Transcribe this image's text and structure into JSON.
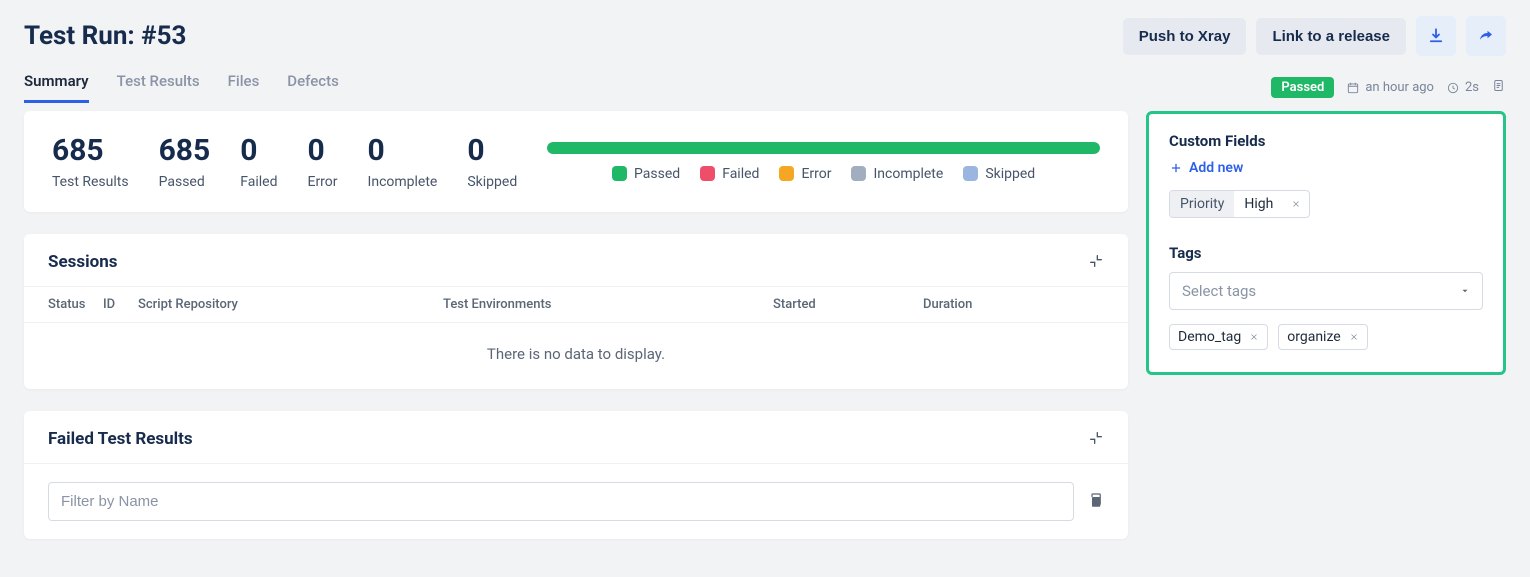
{
  "header": {
    "title": "Test Run: #53",
    "push_label": "Push to Xray",
    "link_label": "Link to a release"
  },
  "tabs": [
    "Summary",
    "Test Results",
    "Files",
    "Defects"
  ],
  "meta": {
    "status_badge": "Passed",
    "timestamp": "an hour ago",
    "duration": "2s"
  },
  "stats": {
    "test_results": {
      "value": "685",
      "label": "Test Results"
    },
    "passed": {
      "value": "685",
      "label": "Passed"
    },
    "failed": {
      "value": "0",
      "label": "Failed"
    },
    "error": {
      "value": "0",
      "label": "Error"
    },
    "incomplete": {
      "value": "0",
      "label": "Incomplete"
    },
    "skipped": {
      "value": "0",
      "label": "Skipped"
    }
  },
  "legend": {
    "passed": "Passed",
    "failed": "Failed",
    "error": "Error",
    "incomplete": "Incomplete",
    "skipped": "Skipped"
  },
  "sessions": {
    "title": "Sessions",
    "columns": {
      "status": "Status",
      "id": "ID",
      "repo": "Script Repository",
      "env": "Test Environments",
      "started": "Started",
      "duration": "Duration"
    },
    "empty": "There is no data to display."
  },
  "failed_results": {
    "title": "Failed Test Results",
    "filter_placeholder": "Filter by Name"
  },
  "sidebar": {
    "custom_fields_title": "Custom Fields",
    "add_new": "Add new",
    "field": {
      "key": "Priority",
      "value": "High"
    },
    "tags_title": "Tags",
    "tags_placeholder": "Select tags",
    "tags": [
      "Demo_tag",
      "organize"
    ]
  }
}
